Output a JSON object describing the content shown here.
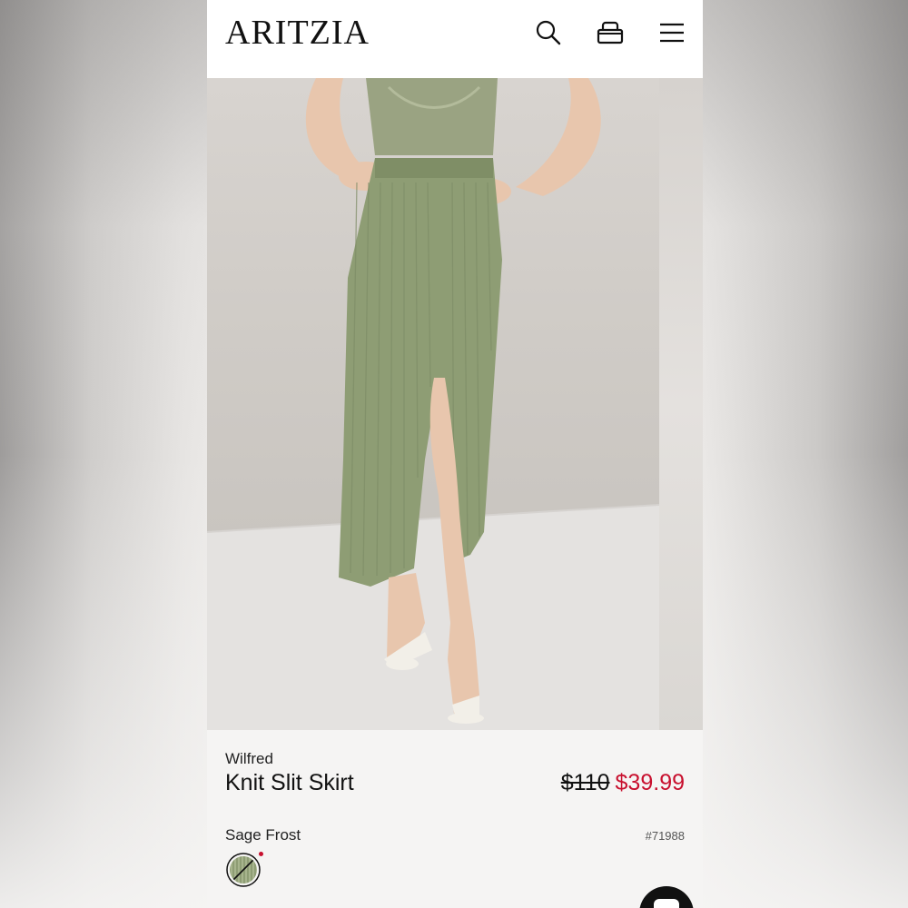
{
  "header": {
    "logo_text": "ARITZIA",
    "icons": [
      "search-icon",
      "shopping-bag-icon",
      "menu-icon"
    ]
  },
  "product": {
    "brand": "Wilfred",
    "name": "Knit Slit Skirt",
    "original_price": "$110",
    "sale_price": "$39.99",
    "color_name": "Sage Frost",
    "sku": "#71988"
  },
  "colors": {
    "sale": "#c8102e",
    "product": "#8e9d74",
    "header_bg": "#ffffff"
  }
}
